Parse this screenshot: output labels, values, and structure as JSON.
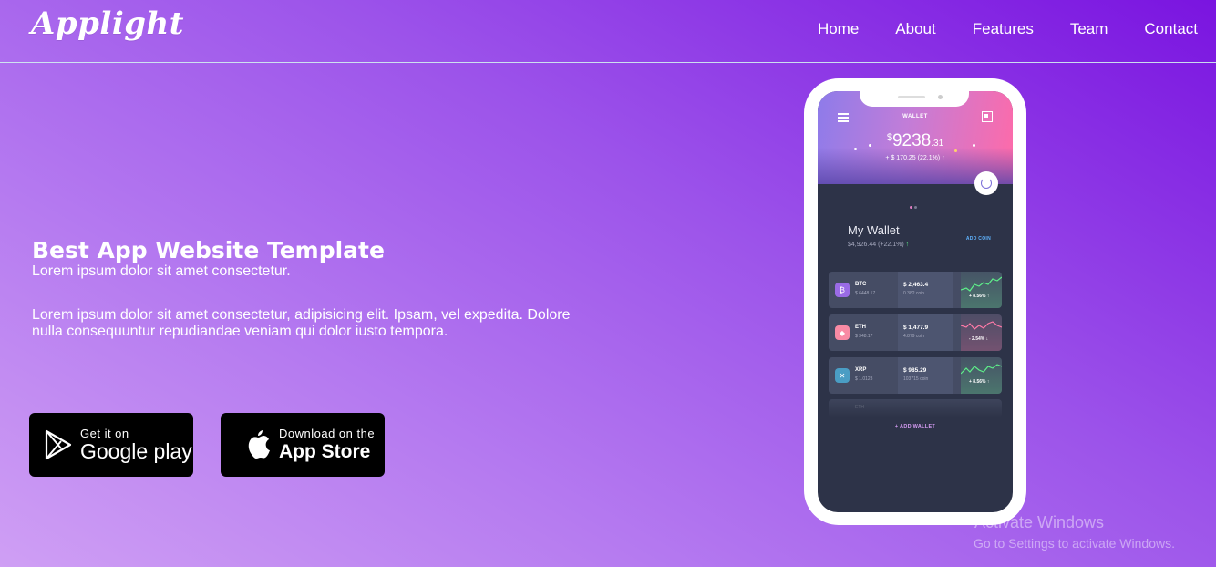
{
  "brand": {
    "logo_text": "Applight"
  },
  "nav": {
    "items": [
      {
        "label": "Home"
      },
      {
        "label": "About"
      },
      {
        "label": "Features"
      },
      {
        "label": "Team"
      },
      {
        "label": "Contact"
      }
    ]
  },
  "hero": {
    "title": "Best App Website Template",
    "subtitle": "Lorem ipsum dolor sit amet consectetur.",
    "body": "Lorem ipsum dolor sit amet consectetur, adipisicing elit. Ipsam, vel expedita. Dolore nulla consequuntur repudiandae veniam qui dolor iusto tempora."
  },
  "store_buttons": {
    "google": {
      "small": "Get it on",
      "big": "Google play",
      "icon": "google-play-icon"
    },
    "apple": {
      "small": "Download on the",
      "big": "App Store",
      "icon": "apple-icon"
    }
  },
  "phone": {
    "header_title": "WALLET",
    "balance_currency": "$",
    "balance_main": "9238",
    "balance_decimal": ".31",
    "balance_change": "+ $ 170.25 (22.1%) ↑",
    "my_wallet_title": "My Wallet",
    "my_wallet_value": "$4,926.44 (+22.1%)",
    "my_wallet_arrow": "↑",
    "add_coin": "ADD COIN",
    "coins": [
      {
        "name": "BTC",
        "usd": "$ 6448.17",
        "price": "$ 2,463.4",
        "amount": "0.382 coin",
        "change": "+ 8.56% ↑",
        "color": "#9a6be6",
        "trend": "up"
      },
      {
        "name": "ETH",
        "usd": "$ 348.17",
        "price": "$ 1,477.9",
        "amount": "4.879 coin",
        "change": "- 2.54% ↓",
        "color": "#f88aa4",
        "trend": "down"
      },
      {
        "name": "XRP",
        "usd": "$ 1.0123",
        "price": "$ 985.29",
        "amount": "103715 coin",
        "change": "+ 8.56% ↑",
        "color": "#4a9dc4",
        "trend": "up"
      }
    ],
    "faded_coin": "ETH",
    "add_wallet": "+ ADD WALLET"
  },
  "os_watermark": {
    "title": "Activate Windows",
    "subtitle": "Go to Settings to activate Windows."
  },
  "colors": {
    "background_start": "#cf9ff4",
    "background_end": "#7a14e0",
    "button_bg": "#000000",
    "positive": "#5ef08a",
    "negative": "#ff6496"
  }
}
